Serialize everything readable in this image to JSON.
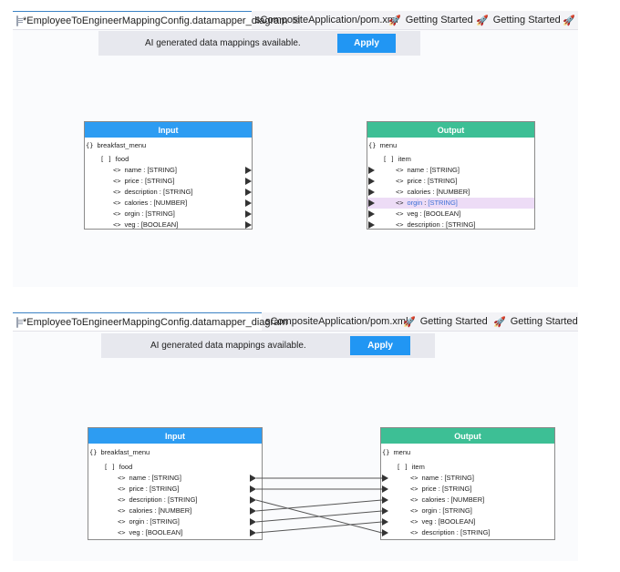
{
  "tabs": [
    {
      "label": "*EmployeeToEngineerMappingConfig.datamapper_diagram",
      "close": "☒"
    },
    {
      "label": "sCompositeApplication/pom.xml"
    },
    {
      "label": "Getting Started"
    },
    {
      "label": "Getting Started"
    }
  ],
  "banner": {
    "message": "AI generated data mappings available.",
    "apply_label": "Apply",
    "apply_color": "#2196f3"
  },
  "input": {
    "title": "Input",
    "root": "breakfast_menu",
    "array": "food",
    "fields": [
      {
        "name": "name",
        "type": "[STRING]"
      },
      {
        "name": "price",
        "type": "[STRING]"
      },
      {
        "name": "description",
        "type": "[STRING]"
      },
      {
        "name": "calories",
        "type": "[NUMBER]"
      },
      {
        "name": "orgin",
        "type": "[STRING]"
      },
      {
        "name": "veg",
        "type": "[BOOLEAN]"
      }
    ]
  },
  "output": {
    "title": "Output",
    "root": "menu",
    "array": "item",
    "fields": [
      {
        "name": "name",
        "type": "[STRING]"
      },
      {
        "name": "price",
        "type": "[STRING]"
      },
      {
        "name": "calories",
        "type": "[NUMBER]"
      },
      {
        "name": "orgin",
        "type": "[STRING]"
      },
      {
        "name": "veg",
        "type": "[BOOLEAN]"
      },
      {
        "name": "description",
        "type": "[STRING]"
      }
    ]
  },
  "symbols": {
    "object": "{}",
    "array": "[ ]",
    "field": "<>"
  },
  "colors": {
    "input_header": "#2d9cf2",
    "output_header": "#3dbf95",
    "highlight": "#eddcf6"
  },
  "top_pane": {
    "highlighted_output_field": "orgin"
  },
  "bottom_pane": {
    "mappings": [
      {
        "from": "name",
        "to": "name"
      },
      {
        "from": "price",
        "to": "price"
      },
      {
        "from": "description",
        "to": "description"
      },
      {
        "from": "calories",
        "to": "calories"
      },
      {
        "from": "orgin",
        "to": "orgin"
      },
      {
        "from": "veg",
        "to": "veg"
      }
    ]
  }
}
